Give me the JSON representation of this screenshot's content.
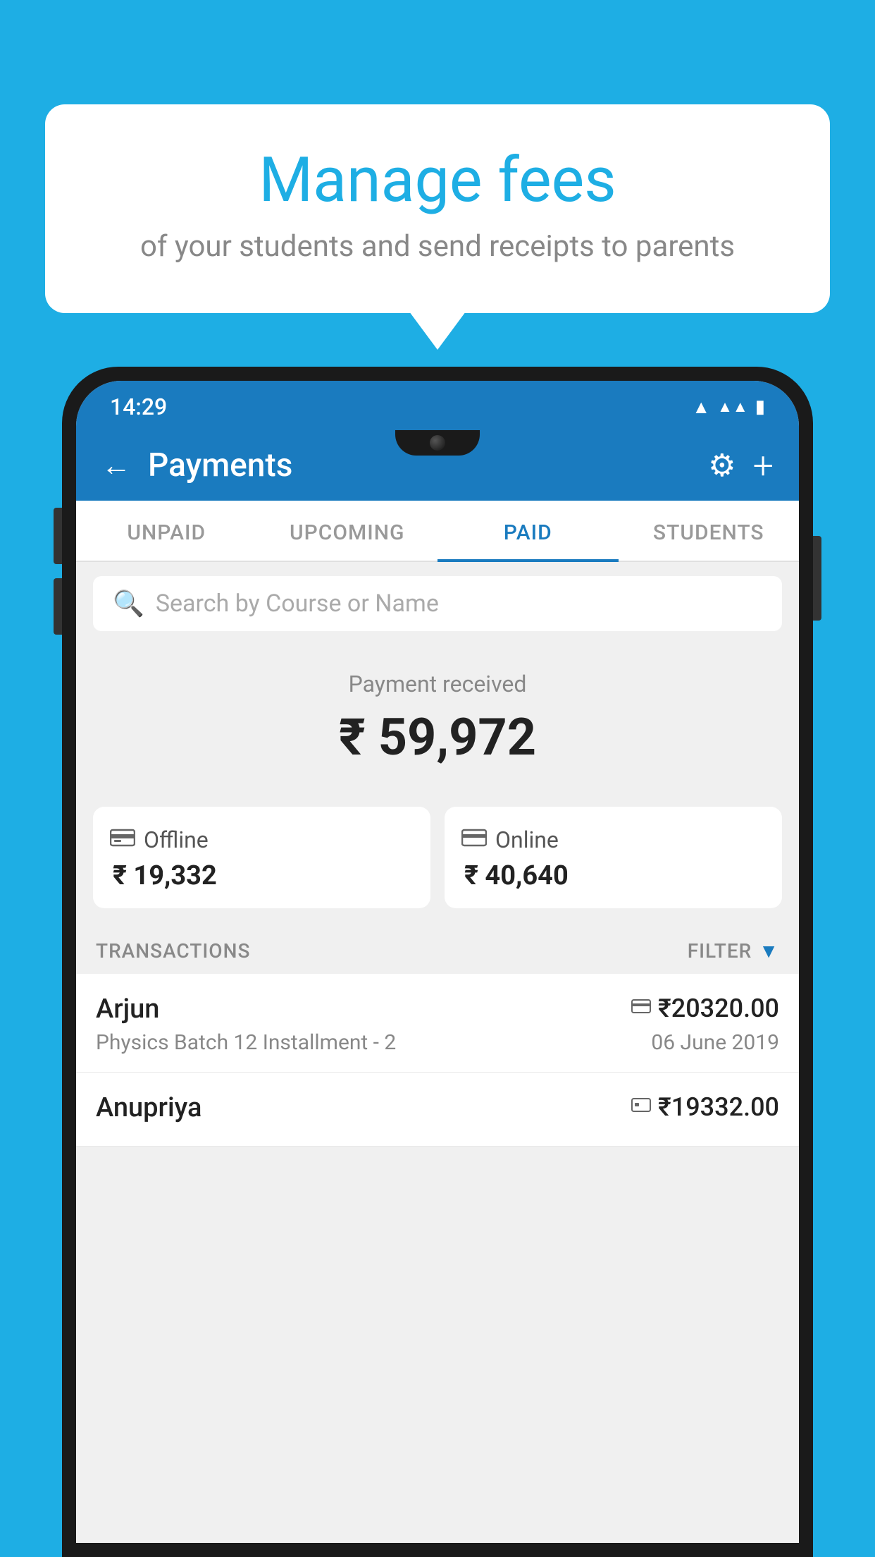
{
  "background_color": "#1EAEE4",
  "speech_bubble": {
    "title": "Manage fees",
    "subtitle": "of your students and send receipts to parents"
  },
  "phone": {
    "status_bar": {
      "time": "14:29",
      "wifi": "▲",
      "signal": "▲",
      "battery": "▮"
    },
    "app_bar": {
      "back_icon": "←",
      "title": "Payments",
      "settings_icon": "⚙",
      "add_icon": "+"
    },
    "tabs": [
      {
        "label": "UNPAID",
        "active": false
      },
      {
        "label": "UPCOMING",
        "active": false
      },
      {
        "label": "PAID",
        "active": true
      },
      {
        "label": "STUDENTS",
        "active": false
      }
    ],
    "search": {
      "placeholder": "Search by Course or Name",
      "icon": "🔍"
    },
    "payment_received": {
      "label": "Payment received",
      "amount": "₹ 59,972",
      "offline": {
        "label": "Offline",
        "amount": "₹ 19,332",
        "icon": "💳"
      },
      "online": {
        "label": "Online",
        "amount": "₹ 40,640",
        "icon": "💳"
      }
    },
    "transactions": {
      "label": "TRANSACTIONS",
      "filter_label": "FILTER",
      "rows": [
        {
          "name": "Arjun",
          "course": "Physics Batch 12 Installment - 2",
          "amount": "₹20320.00",
          "date": "06 June 2019",
          "type_icon": "💳"
        },
        {
          "name": "Anupriya",
          "course": "",
          "amount": "₹19332.00",
          "date": "",
          "type_icon": "💴"
        }
      ]
    }
  }
}
